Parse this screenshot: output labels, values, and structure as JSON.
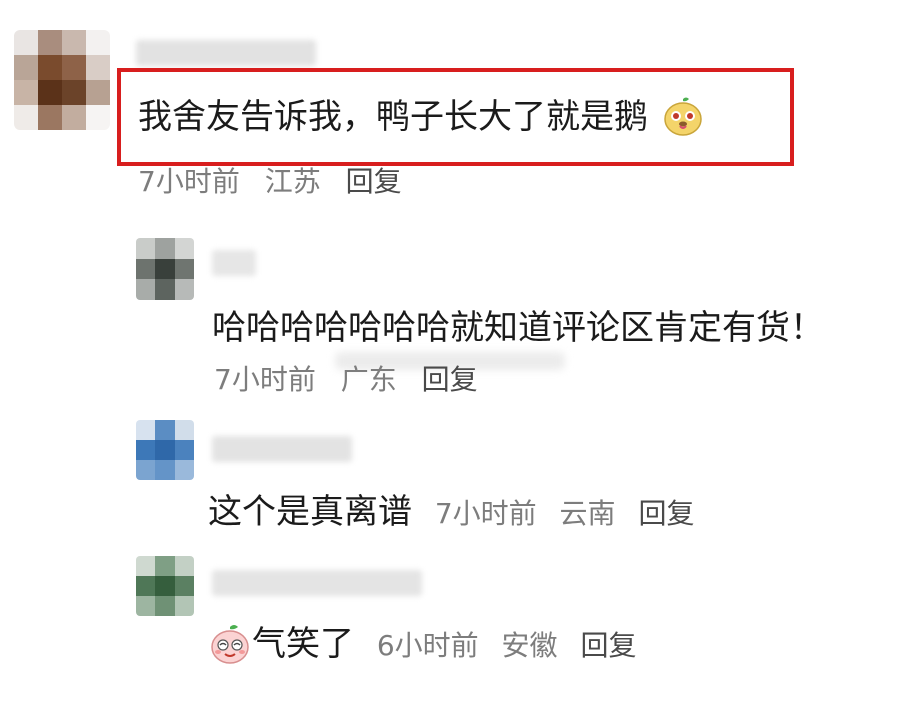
{
  "comments": [
    {
      "text": "我舍友告诉我，鸭子长大了就是鹅",
      "emoji": "duck-emoji",
      "time": "7小时前",
      "location": "江苏",
      "reply": "回复",
      "highlighted": true
    },
    {
      "text": "哈哈哈哈哈哈哈就知道评论区肯定有货！",
      "time": "7小时前",
      "location": "广东",
      "reply": "回复"
    },
    {
      "text": "这个是真离谱",
      "time": "7小时前",
      "location": "云南",
      "reply": "回复"
    },
    {
      "text": "气笑了",
      "emoji": "laughing-peach-emoji",
      "time": "6小时前",
      "location": "安徽",
      "reply": "回复"
    }
  ],
  "colors": {
    "highlight_border": "#d81e1e",
    "meta_text": "#7d7d7d",
    "body_text": "#1b1b1b"
  }
}
